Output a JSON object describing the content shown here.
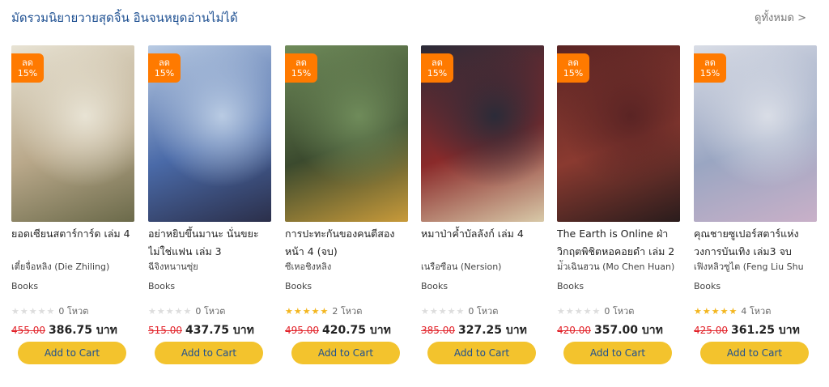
{
  "section": {
    "title": "มัดรวมนิยายวายสุดจิ้น อินจนหยุดอ่านไม่ได้",
    "view_all": "ดูทั้งหมด >"
  },
  "currency": "บาท",
  "products": [
    {
      "discount_label": "ลด",
      "discount_value": "15%",
      "title": "ยอดเซียนสตาร์การ์ด เล่ม 4",
      "author": "เตี๋ยจื่อหลิง (Die Zhiling)",
      "category": "Books",
      "rating": 0,
      "votes": "0 โหวต",
      "old_price": "455.00",
      "new_price": "386.75 บาท",
      "cart_label": "Add to Cart",
      "cover_colors": [
        "#e8e3d4",
        "#b9a88a",
        "#6b6a4a"
      ]
    },
    {
      "discount_label": "ลด",
      "discount_value": "15%",
      "title": "อย่าหยิบขึ้นมานะ นั่นขยะ ไม่ใช่แฟน เล่ม 3",
      "author": "ฉีจิงหนานซุ่ย",
      "category": "Books",
      "rating": 0,
      "votes": "0 โหวต",
      "old_price": "515.00",
      "new_price": "437.75 บาท",
      "cart_label": "Add to Cart",
      "cover_colors": [
        "#b9cbe3",
        "#4a6aa8",
        "#2b2f4a"
      ]
    },
    {
      "discount_label": "ลด",
      "discount_value": "15%",
      "title": "การปะทะกันของคนตีสองหน้า 4 (จบ)",
      "author": "ซีเหอชิงหลิง",
      "category": "Books",
      "rating": 5,
      "votes": "2 โหวต",
      "old_price": "495.00",
      "new_price": "420.75 บาท",
      "cart_label": "Add to Cart",
      "cover_colors": [
        "#6f8b5a",
        "#3b4a2e",
        "#c89a3a"
      ]
    },
    {
      "discount_label": "ลด",
      "discount_value": "15%",
      "title": "หมาป่าค้ำบัลลังก์ เล่ม 4",
      "author": "เนรือซือน (Nersion)",
      "category": "Books",
      "rating": 0,
      "votes": "0 โหวต",
      "old_price": "385.00",
      "new_price": "327.25 บาท",
      "cart_label": "Add to Cart",
      "cover_colors": [
        "#2b2b38",
        "#8a2a2a",
        "#d8c9a8"
      ]
    },
    {
      "discount_label": "ลด",
      "discount_value": "15%",
      "title": "The Earth is Online ฝ่าวิกฤตพิชิตหอคอยดำ เล่ม 2",
      "author": "ม่ัวเฉินฮวน (Mo Chen Huan)",
      "category": "Books",
      "rating": 0,
      "votes": "0 โหวต",
      "old_price": "420.00",
      "new_price": "357.00 บาท",
      "cart_label": "Add to Cart",
      "cover_colors": [
        "#5a2424",
        "#8a3a30",
        "#2a1c1c"
      ]
    },
    {
      "discount_label": "ลด",
      "discount_value": "15%",
      "title": "คุณชายซูเปอร์สตาร์แห่งวงการบันเทิง เล่ม3 จบ",
      "author": "เฟิงหลิวซูไต (Feng Liu Shu",
      "category": "Books",
      "rating": 5,
      "votes": "4 โหวต",
      "old_price": "425.00",
      "new_price": "361.25 บาท",
      "cart_label": "Add to Cart",
      "cover_colors": [
        "#d9dde6",
        "#9aa6c2",
        "#c9b0c8"
      ]
    }
  ]
}
